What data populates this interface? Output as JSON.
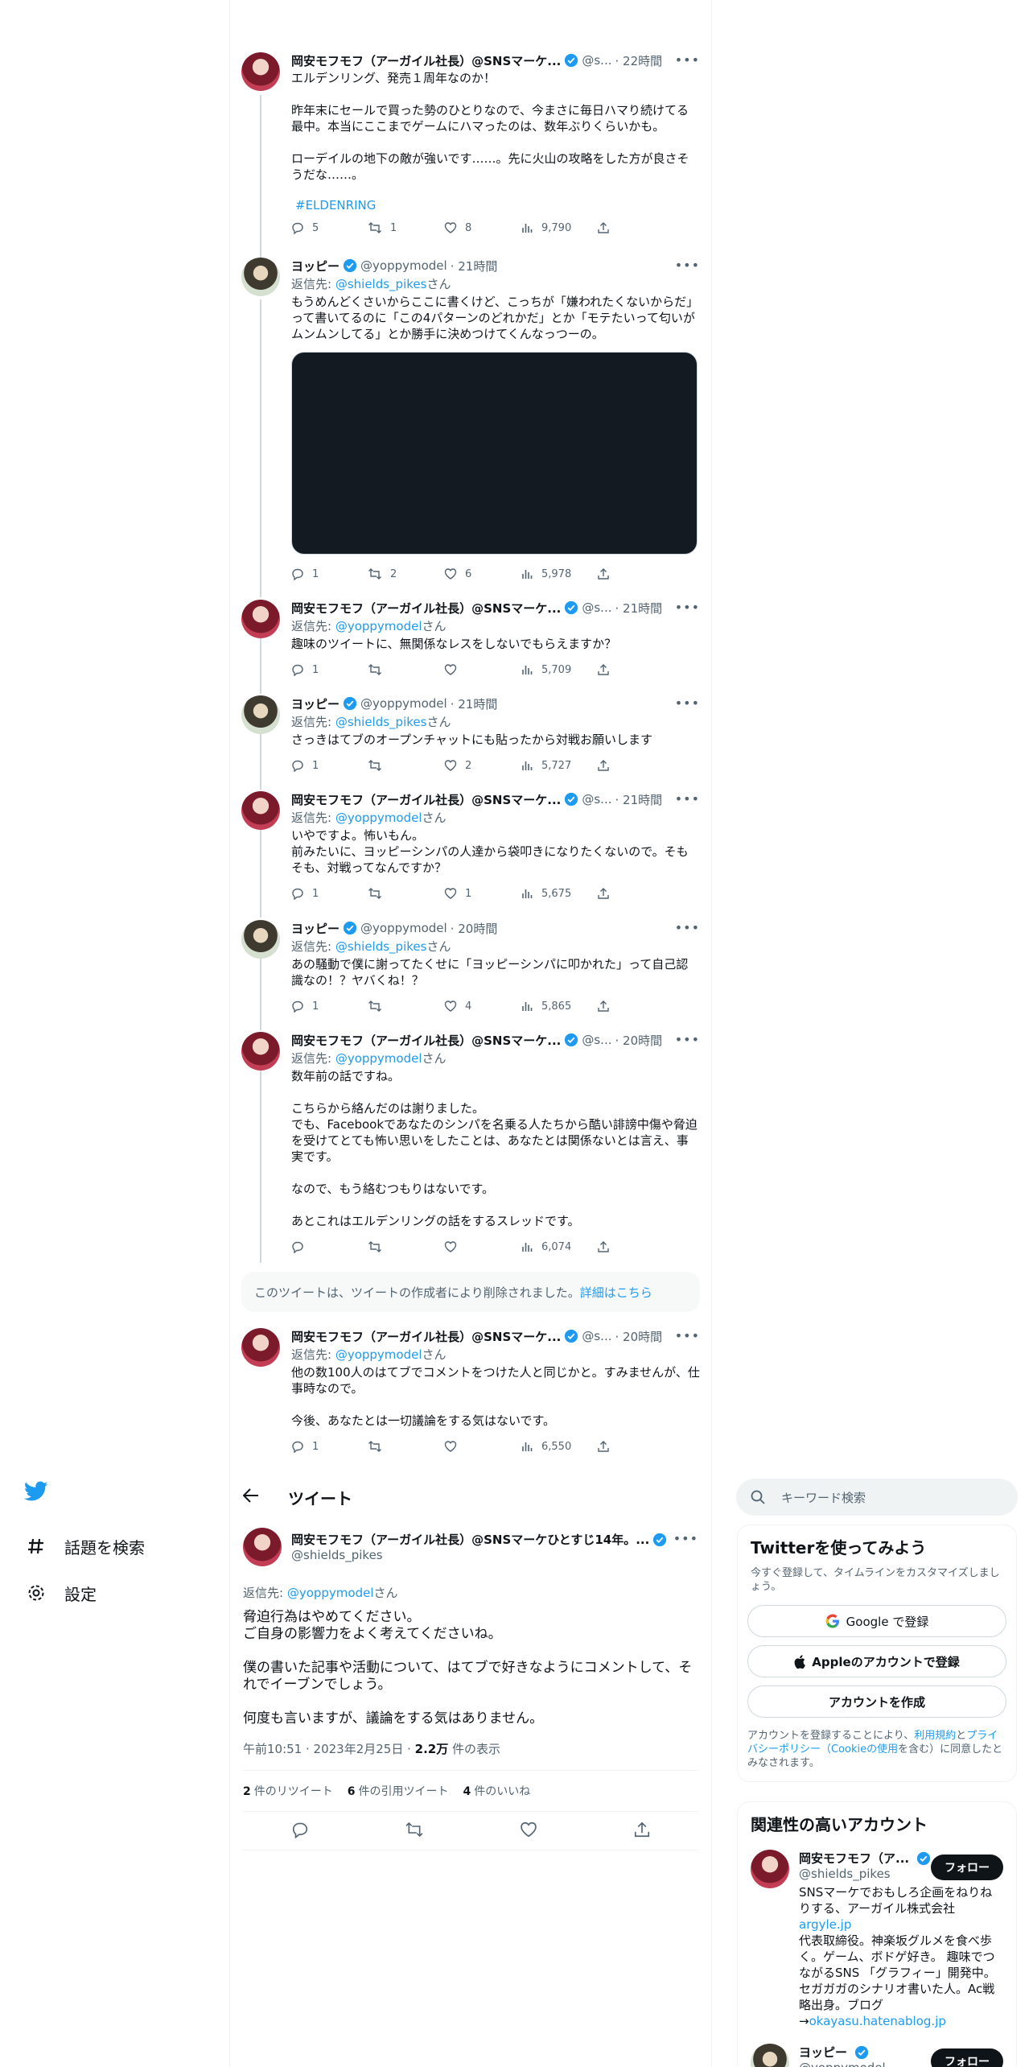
{
  "nav": {
    "items": [
      {
        "label": "話題を検索",
        "icon": "hashtag-icon"
      },
      {
        "label": "設定",
        "icon": "gear-icon"
      }
    ]
  },
  "thread": [
    {
      "name": "岡安モフモフ（アーガイル社長）@SNSマーケ...",
      "handle": "@s...",
      "time": "· 22時間",
      "reply_prefix": "",
      "reply_to": "",
      "reply_suffix": "",
      "text": "エルデンリング、発売１周年なのか！\n\n昨年末にセールで買った勢のひとりなので、今まさに毎日ハマり続けてる最中。本当にここまでゲームにハマったのは、数年ぶりくらいかも。\n\nローデイルの地下の敵が強いです……。先に火山の攻略をした方が良さそうだな……。",
      "hashtag": "#ELDENRING",
      "replies": "5",
      "retweets": "1",
      "likes": "8",
      "views": "9,790"
    },
    {
      "name": "ヨッピー",
      "handle": "@yoppymodel",
      "time": "· 21時間",
      "reply_prefix": "返信先: ",
      "reply_to": "@shields_pikes",
      "reply_suffix": "さん",
      "text": "もうめんどくさいからここに書くけど、こっちが「嫌われたくないからだ」って書いてるのに「この4パターンのどれかだ」とか「モテたいって匂いがムンムンしてる」とか勝手に決めつけてくんなっつーの。",
      "replies": "1",
      "retweets": "2",
      "likes": "6",
      "views": "5,978"
    },
    {
      "name": "岡安モフモフ（アーガイル社長）@SNSマーケ...",
      "handle": "@s...",
      "time": "· 21時間",
      "reply_prefix": "返信先: ",
      "reply_to": "@yoppymodel",
      "reply_suffix": "さん",
      "text": "趣味のツイートに、無関係なレスをしないでもらえますか？",
      "replies": "1",
      "retweets": "",
      "likes": "",
      "views": "5,709"
    },
    {
      "name": "ヨッピー",
      "handle": "@yoppymodel",
      "time": "· 21時間",
      "reply_prefix": "返信先: ",
      "reply_to": "@shields_pikes",
      "reply_suffix": "さん",
      "text": "さっきはてブのオープンチャットにも貼ったから対戦お願いします",
      "replies": "1",
      "retweets": "",
      "likes": "2",
      "views": "5,727"
    },
    {
      "name": "岡安モフモフ（アーガイル社長）@SNSマーケ...",
      "handle": "@s...",
      "time": "· 21時間",
      "reply_prefix": "返信先: ",
      "reply_to": "@yoppymodel",
      "reply_suffix": "さん",
      "text": "いやですよ。怖いもん。\n前みたいに、ヨッピーシンパの人達から袋叩きになりたくないので。そもそも、対戦ってなんですか？",
      "replies": "1",
      "retweets": "",
      "likes": "1",
      "views": "5,675"
    },
    {
      "name": "ヨッピー",
      "handle": "@yoppymodel",
      "time": "· 20時間",
      "reply_prefix": "返信先: ",
      "reply_to": "@shields_pikes",
      "reply_suffix": "さん",
      "text": "あの騒動で僕に謝ってたくせに「ヨッピーシンパに叩かれた」って自己認識なの！？ヤバくね！？",
      "replies": "1",
      "retweets": "",
      "likes": "4",
      "views": "5,865"
    },
    {
      "name": "岡安モフモフ（アーガイル社長）@SNSマーケ...",
      "handle": "@s...",
      "time": "· 20時間",
      "reply_prefix": "返信先: ",
      "reply_to": "@yoppymodel",
      "reply_suffix": "さん",
      "text": "数年前の話ですね。\n\nこちらから絡んだのは謝りました。\nでも、Facebookであなたのシンパを名乗る人たちから酷い誹謗中傷や脅迫を受けてとても怖い思いをしたことは、あなたとは関係ないとは言え、事実です。\n\nなので、もう絡むつもりはないです。\n\nあとこれはエルデンリングの話をするスレッドです。",
      "replies": "",
      "retweets": "",
      "likes": "",
      "views": "6,074"
    },
    {
      "name": "岡安モフモフ（アーガイル社長）@SNSマーケ...",
      "handle": "@s...",
      "time": "· 20時間",
      "reply_prefix": "返信先: ",
      "reply_to": "@yoppymodel",
      "reply_suffix": "さん",
      "text": "他の数100人のはてブでコメントをつけた人と同じかと。すみませんが、仕事時なので。\n\n今後、あなたとは一切議論をする気はないです。",
      "replies": "1",
      "retweets": "",
      "likes": "",
      "views": "6,550"
    }
  ],
  "deleted_notice": {
    "text": "このツイートは、ツイートの作成者により削除されました。",
    "link": "詳細はこちら"
  },
  "header": {
    "title": "ツイート"
  },
  "main_tweet": {
    "name": "岡安モフモフ（アーガイル社長）@SNSマーケひとすじ14年。...",
    "handle": "@shields_pikes",
    "reply_prefix": "返信先: ",
    "reply_to": "@yoppymodel",
    "reply_suffix": "さん",
    "text": "脅迫行為はやめてください。\nご自身の影響力をよく考えてくださいね。\n\n僕の書いた記事や活動について、はてブで好きなようにコメントして、それでイーブンでしょう。\n\n何度も言いますが、議論をする気はありません。",
    "time": "午前10:51 · 2023年2月25日 · ",
    "views": "2.2万",
    "views_label": " 件の表示",
    "retweets": "2",
    "retweets_label": "件のリツイート",
    "quotes": "6",
    "quotes_label": "件の引用ツイート",
    "likes": "4",
    "likes_label": "件のいいね"
  },
  "search": {
    "placeholder": "キーワード検索"
  },
  "signup": {
    "title": "Twitterを使ってみよう",
    "desc": "今すぐ登録して、タイムラインをカスタマイズしましょう。",
    "google": "Google で登録",
    "apple": "Appleのアカウントで登録",
    "create": "アカウントを作成",
    "terms_1": "アカウントを登録することにより、",
    "terms_link1": "利用規約",
    "terms_2": "と",
    "terms_link2": "プライバシーポリシー（Cookieの使用",
    "terms_3": "を含む）に同意したとみなされます。"
  },
  "related": {
    "title": "関連性の高いアカウント",
    "follow": "フォロー",
    "accounts": [
      {
        "name": "岡安モフモフ（ア...",
        "handle": "@shields_pikes",
        "bio_1": "SNSマーケでおもしろ企画をねりねりする、アーガイル株式会社 ",
        "bio_link1": "argyle.jp",
        "bio_2": "\n代表取締役。神楽坂グルメを食べ歩く。ゲーム、ボドゲ好き。 趣味でつながるSNS 「グラフィー」開発中。セガガガのシナリオ書いた人。Ac戦略出身。ブログ→",
        "bio_link2": "okayasu.hatenablog.jp"
      },
      {
        "name": "ヨッピー",
        "handle": "@yoppymodel"
      }
    ]
  },
  "colors": {
    "accent": "#1d9bf0",
    "text": "#0f1419",
    "muted": "#536471",
    "border": "#eff3f4"
  }
}
